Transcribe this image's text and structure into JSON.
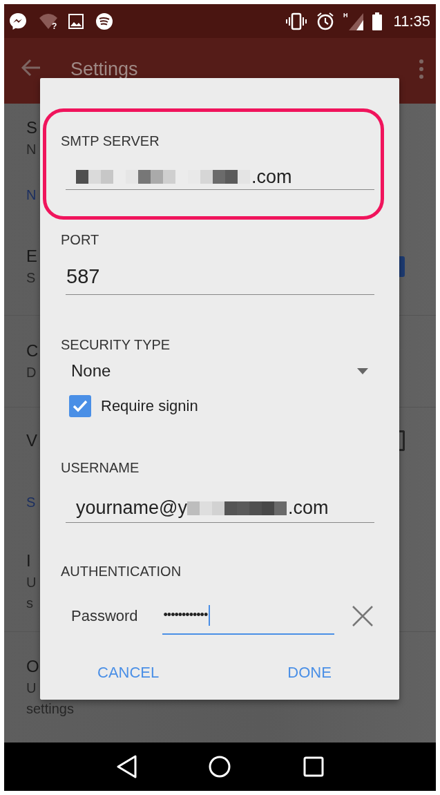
{
  "status_bar": {
    "wifi_badge": "?",
    "network_type": "H",
    "time": "11:35"
  },
  "toolbar": {
    "title": "Settings"
  },
  "background_list": [
    {
      "kind": "item",
      "title": "S",
      "subtitle": "N"
    },
    {
      "kind": "section",
      "title": "N"
    },
    {
      "kind": "item",
      "title": "E",
      "subtitle": "S",
      "checkbox": true,
      "checked": true
    },
    {
      "kind": "item",
      "title": "C",
      "subtitle": "D"
    },
    {
      "kind": "item",
      "title": "V",
      "checkbox": true,
      "checked": false
    },
    {
      "kind": "section",
      "title": "S"
    },
    {
      "kind": "item",
      "title": "I",
      "subtitle": "U",
      "subtitle_2": "s"
    },
    {
      "kind": "item",
      "title": "O",
      "subtitle": "U",
      "subtitle_2": "settings"
    }
  ],
  "dialog": {
    "smtp_server": {
      "label": "SMTP SERVER",
      "value_suffix": ".com",
      "highlighted": true
    },
    "port": {
      "label": "PORT",
      "value": "587"
    },
    "security_type": {
      "label": "SECURITY TYPE",
      "value": "None",
      "require_signin": {
        "label": "Require signin",
        "checked": true
      }
    },
    "username": {
      "label": "USERNAME",
      "value": "yourname@y",
      "value_suffix": ".com"
    },
    "authentication": {
      "label": "AUTHENTICATION",
      "field_label": "Password",
      "value": "••••••••••••",
      "focused": true
    },
    "buttons": [
      "CANCEL",
      "DONE"
    ]
  }
}
